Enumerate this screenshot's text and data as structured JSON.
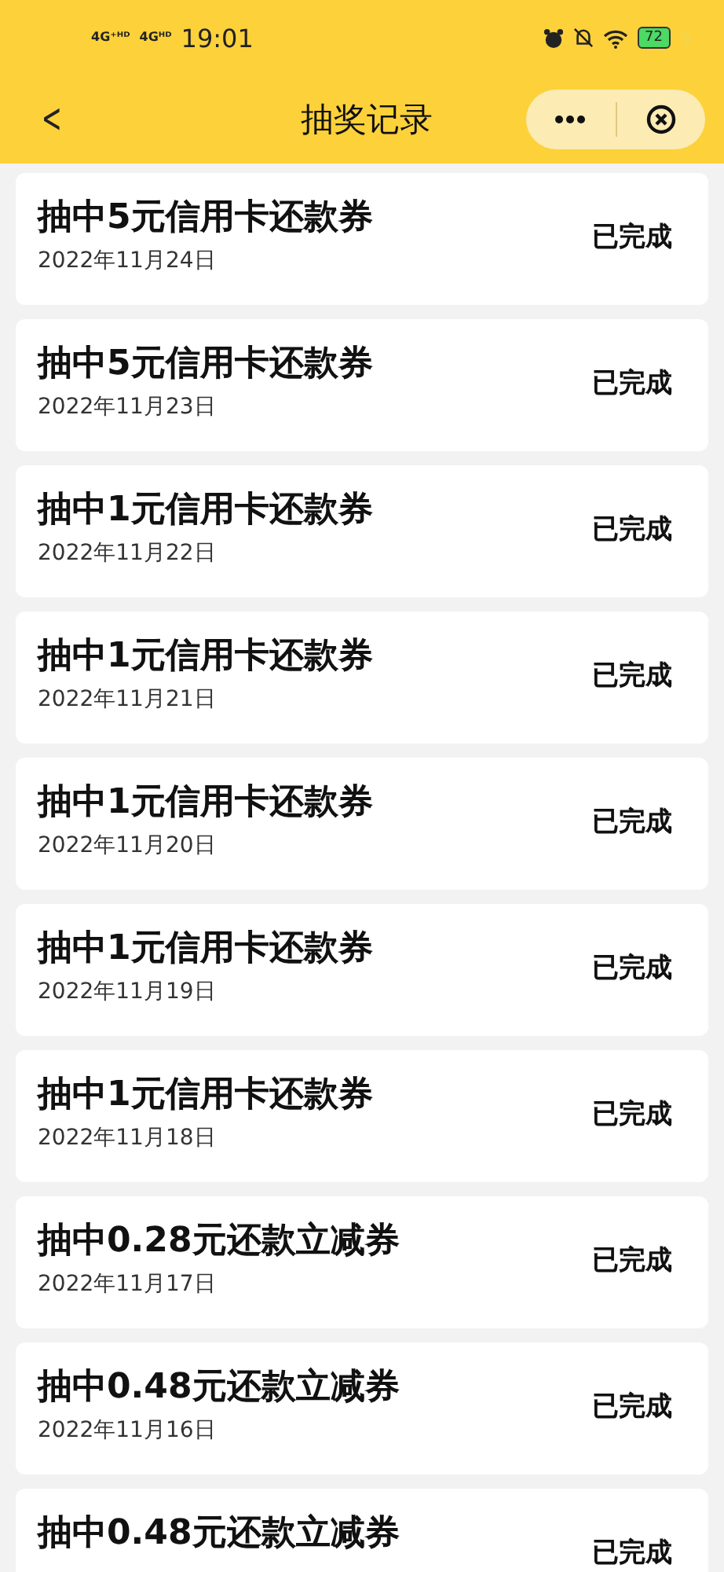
{
  "status_bar": {
    "network_1": "4G⁺ᴴᴰ",
    "network_2": "4Gᴴᴰ",
    "time": "19:01",
    "battery": "72"
  },
  "nav": {
    "back": "<",
    "title": "抽奖记录"
  },
  "records": [
    {
      "title": "抽中5元信用卡还款券",
      "date": "2022年11月24日",
      "status": "已完成"
    },
    {
      "title": "抽中5元信用卡还款券",
      "date": "2022年11月23日",
      "status": "已完成"
    },
    {
      "title": "抽中1元信用卡还款券",
      "date": "2022年11月22日",
      "status": "已完成"
    },
    {
      "title": "抽中1元信用卡还款券",
      "date": "2022年11月21日",
      "status": "已完成"
    },
    {
      "title": "抽中1元信用卡还款券",
      "date": "2022年11月20日",
      "status": "已完成"
    },
    {
      "title": "抽中1元信用卡还款券",
      "date": "2022年11月19日",
      "status": "已完成"
    },
    {
      "title": "抽中1元信用卡还款券",
      "date": "2022年11月18日",
      "status": "已完成"
    },
    {
      "title": "抽中0.28元还款立减券",
      "date": "2022年11月17日",
      "status": "已完成"
    },
    {
      "title": "抽中0.48元还款立减券",
      "date": "2022年11月16日",
      "status": "已完成"
    },
    {
      "title": "抽中0.48元还款立减券",
      "status": "已完成"
    }
  ]
}
